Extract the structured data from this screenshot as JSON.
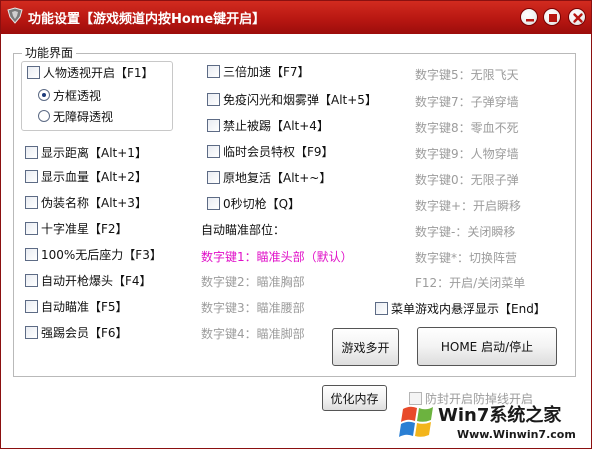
{
  "window": {
    "title": "功能设置【游戏频道内按Home键开启】"
  },
  "panel": {
    "title": "功能界面"
  },
  "left_options": {
    "perspective": "人物透视开启【F1】",
    "radio_box": "方框透视",
    "radio_free": "无障碍透视",
    "show_distance": "显示距离【Alt+1】",
    "show_hp": "显示血量【Alt+2】",
    "disguise_name": "伪装名称【Alt+3】",
    "crosshair": "十字准星【F2】",
    "no_recoil": "100%无后座力【F3】",
    "auto_headshot": "自动开枪爆头【F4】",
    "auto_aim": "自动瞄准【F5】",
    "kick_member": "强踢会员【F6】"
  },
  "middle_options": {
    "triple_speed": "三倍加速【F7】",
    "no_flash_smoke": "免疫闪光和烟雾弹【Alt+5】",
    "no_kick": "禁止被踢【Alt+4】",
    "temp_vip": "临时会员特权【F9】",
    "respawn_in_place": "原地复活【Alt+~】",
    "zero_switch": "0秒切枪【Q】",
    "aim_part_label": "自动瞄准部位：",
    "aim_head": "数字键1：瞄准头部（默认）",
    "aim_chest": "数字键2：瞄准胸部",
    "aim_waist": "数字键3：瞄准腰部",
    "aim_feet": "数字键4：瞄准脚部"
  },
  "right_info": {
    "key5": "数字键5：无限飞天",
    "key7": "数字键7：子弹穿墙",
    "key8": "数字键8：零血不死",
    "key9": "数字键9：人物穿墙",
    "key0": "数字键0：无限子弹",
    "key_plus": "数字键+：开启瞬移",
    "key_minus": "数字键-：关闭瞬移",
    "key_star": "数字键*：切换阵营",
    "f12": "F12：开启/关闭菜单",
    "float_display": "菜单游戏内悬浮显示【End】"
  },
  "buttons": {
    "multi_open": "游戏多开",
    "home_toggle": "HOME 启动/停止",
    "optimize": "优化内存"
  },
  "disabled_option": "防封开启防掉线开启",
  "watermark": {
    "title": "Win7系统之家",
    "url": "Www.Winwin7.com"
  },
  "colors": {
    "titlebar": "#b81712",
    "highlight": "#e010c8",
    "disabled_text": "#9c9c9c"
  },
  "icons": [
    "app-logo-icon",
    "minimize-icon",
    "maximize-icon",
    "close-icon",
    "windows-logo-icon"
  ]
}
